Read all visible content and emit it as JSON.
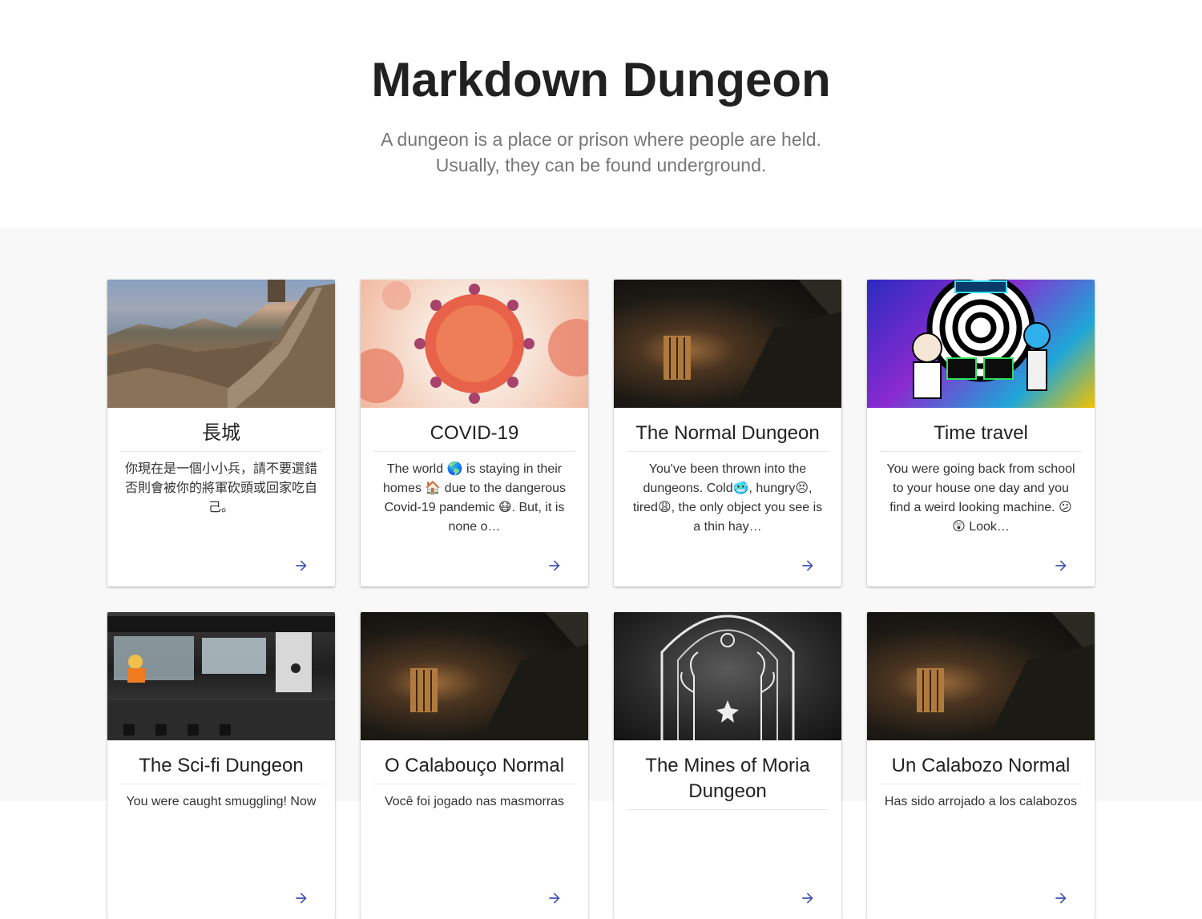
{
  "header": {
    "title": "Markdown Dungeon",
    "subtitle": "A dungeon is a place or prison where people are held. Usually, they can be found underground."
  },
  "cards": [
    {
      "title": "長城",
      "description": "你現在是一個小小兵，請不要選錯否則會被你的將軍砍頭或回家吃自己。",
      "image": "great-wall-image"
    },
    {
      "title": "COVID-19",
      "description": "The world 🌎 is staying in their homes 🏠 due to the dangerous Covid-19 pandemic 😷. But, it is none o…",
      "image": "coronavirus-image"
    },
    {
      "title": "The Normal Dungeon",
      "description": "You've been thrown into the dungeons. Cold🥶, hungry😣, tired😩, the only object you see is a thin hay…",
      "image": "dungeon-cell-image"
    },
    {
      "title": "Time travel",
      "description": "You were going back from school to your house one day and you find a weird looking machine. 😕 😲 Look…",
      "image": "time-machine-image"
    },
    {
      "title": "The Sci-fi Dungeon",
      "description": "You were caught smuggling! Now",
      "image": "scifi-cell-image"
    },
    {
      "title": "O Calabouço Normal",
      "description": "Você foi jogado nas masmorras",
      "image": "dungeon-cell-image"
    },
    {
      "title": "The Mines of Moria Dungeon",
      "description": "",
      "image": "moria-gate-image"
    },
    {
      "title": "Un Calabozo Normal",
      "description": "Has sido arrojado a los calabozos",
      "image": "dungeon-cell-image"
    }
  ],
  "colors": {
    "accent": "#3f51b5",
    "grid_background": "#f8f8f8",
    "subtitle": "#777777"
  },
  "icons": {
    "open": "arrow-right-icon"
  }
}
